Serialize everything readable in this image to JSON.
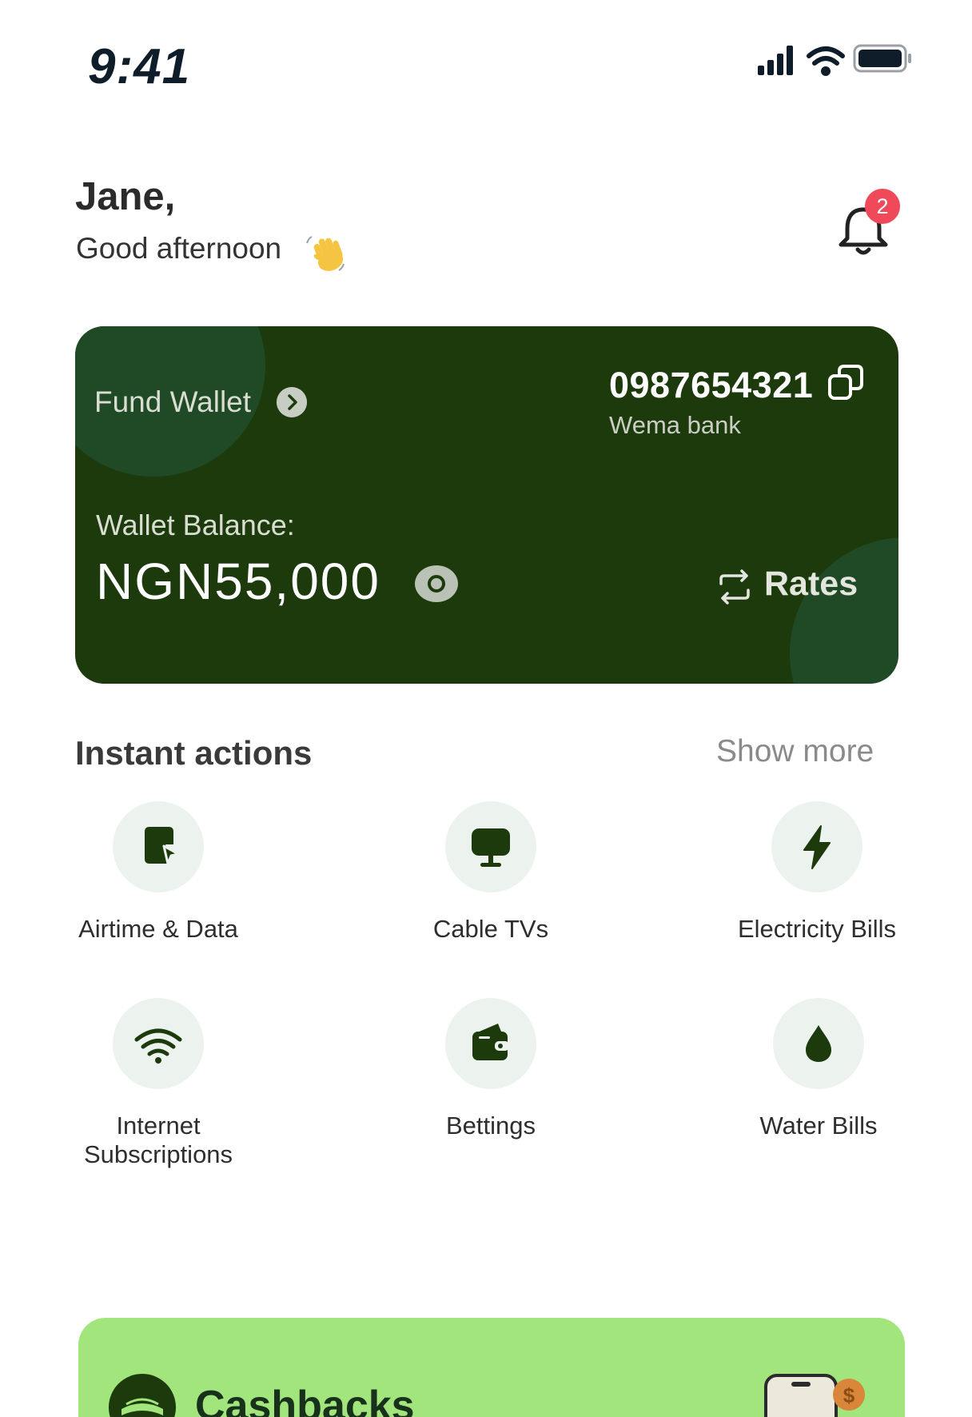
{
  "status": {
    "time": "9:41"
  },
  "greeting": {
    "name": "Jane,",
    "message": "Good afternoon"
  },
  "notifications": {
    "count": "2"
  },
  "wallet": {
    "fund_label": "Fund Wallet",
    "account_number": "0987654321",
    "bank_name": "Wema bank",
    "balance_label": "Wallet Balance:",
    "balance": "NGN55,000",
    "rates_label": "Rates"
  },
  "actions": {
    "title": "Instant actions",
    "show_more": "Show more",
    "items": [
      {
        "label": "Airtime & Data",
        "icon": "airtime-icon"
      },
      {
        "label": "Cable TVs",
        "icon": "tv-icon"
      },
      {
        "label": "Electricity Bills",
        "icon": "lightning-icon"
      },
      {
        "label": "Internet Subscriptions",
        "icon": "wifi-icon"
      },
      {
        "label": "Bettings",
        "icon": "wallet-icon"
      },
      {
        "label": "Water Bills",
        "icon": "water-drop-icon"
      }
    ]
  },
  "cashback": {
    "title": "Cashbacks"
  },
  "colors": {
    "card_bg": "#1c3a0c",
    "card_blob": "#204a25",
    "icon_green": "#1c3a0c",
    "icon_circle": "#ecf3ee",
    "badge": "#f04a5a",
    "cashback_bg": "#a1e57c"
  }
}
